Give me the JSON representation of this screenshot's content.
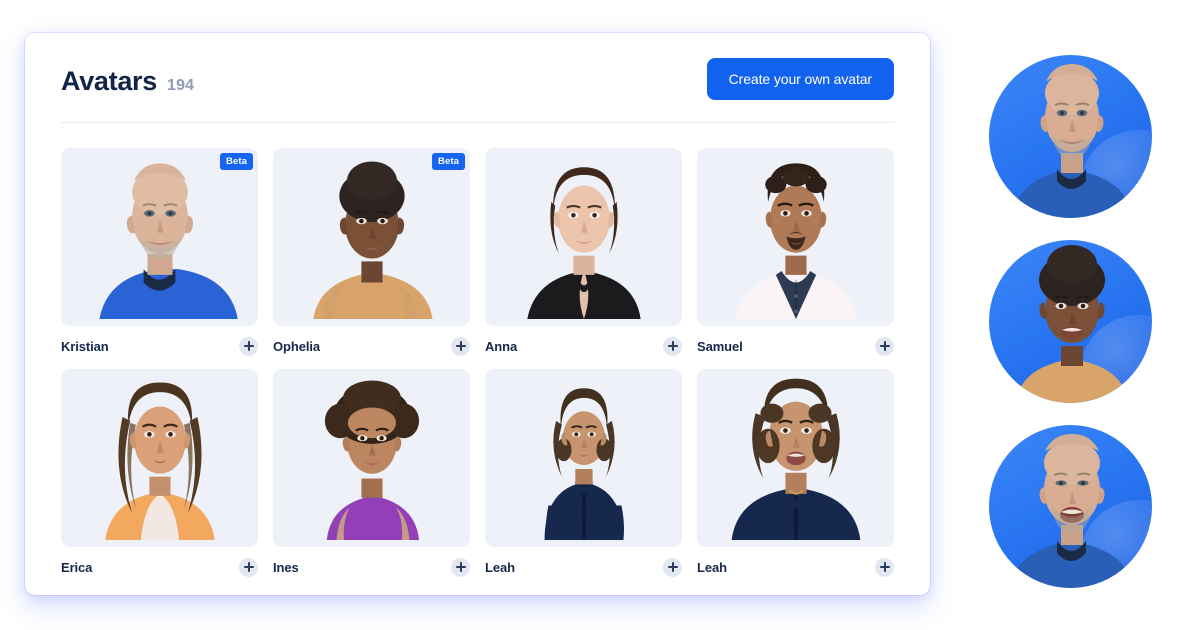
{
  "header": {
    "title": "Avatars",
    "count": "194",
    "cta_label": "Create your own avatar"
  },
  "colors": {
    "accent_blue": "#1262f0",
    "badge_blue": "#1565f2",
    "title_navy": "#122447",
    "count_gray": "#8e9cb8",
    "card_bg": "#eef1f7",
    "plus_circle": "#e2e7f0",
    "panel_glow": "#6e82ff"
  },
  "avatars": [
    {
      "name": "Kristian",
      "badge": "Beta",
      "has_badge": true,
      "add_label": "+"
    },
    {
      "name": "Ophelia",
      "badge": "Beta",
      "has_badge": true,
      "add_label": "+"
    },
    {
      "name": "Anna",
      "badge": "",
      "has_badge": false,
      "add_label": "+"
    },
    {
      "name": "Samuel",
      "badge": "",
      "has_badge": false,
      "add_label": "+"
    },
    {
      "name": "Erica",
      "badge": "",
      "has_badge": false,
      "add_label": "+"
    },
    {
      "name": "Ines",
      "badge": "",
      "has_badge": false,
      "add_label": "+"
    },
    {
      "name": "Leah",
      "badge": "",
      "has_badge": false,
      "add_label": "+"
    },
    {
      "name": "Leah",
      "badge": "",
      "has_badge": false,
      "add_label": "+"
    }
  ],
  "preview_circles": [
    {
      "name": "Kristian"
    },
    {
      "name": "Ophelia"
    },
    {
      "name": "Kristian"
    }
  ]
}
